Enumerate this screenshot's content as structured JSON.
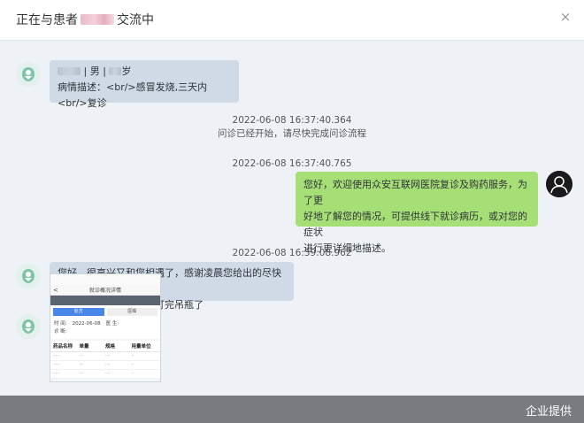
{
  "header": {
    "title_prefix": "正在与患者",
    "title_suffix": "交流中",
    "close_glyph": "×"
  },
  "messages": {
    "patient_info": {
      "gender_segment": "| 男 |",
      "age_suffix": "岁",
      "description": "病情描述：<br/>感冒发烧,三天内<br/>复诊"
    },
    "system_1": {
      "timestamp": "2022-06-08 16:37:40.364",
      "text": "问诊已经开始，请尽快完成问诊流程"
    },
    "system_2": {
      "timestamp": "2022-06-08 16:37:40.765"
    },
    "welcome": {
      "line1": "您好，欢迎使用众安互联网医院复诊及购药服务，为了更",
      "line2": "好地了解您的情况，可提供线下就诊病历，或对您的症状",
      "line3": "进行更详细地描述。"
    },
    "system_3": {
      "timestamp": "2022-06-08 16:39:08.962"
    },
    "patient_reply": {
      "line1": "您好，很高兴又和您相遇了，感谢凌晨您给出的尽快去医",
      "line2": "院的建议，我现在已经打完吊瓶了"
    }
  },
  "card": {
    "nav_back": "<",
    "nav_title": "就诊概况详情",
    "tabs": [
      "处方",
      "医嘱"
    ],
    "info_rows": [
      {
        "label": "时 间:",
        "value": "2022-06-08",
        "label2": "医 生:"
      },
      {
        "label": "诊 断:",
        "value": ""
      }
    ],
    "table_headers": [
      "药品名称",
      "单量",
      "规格",
      "用量单位"
    ]
  },
  "footer": {
    "credit": "企业提供"
  },
  "colors": {
    "bubble_left": "#cfdae6",
    "bubble_right": "#a6df76",
    "background": "#eef2f6"
  }
}
